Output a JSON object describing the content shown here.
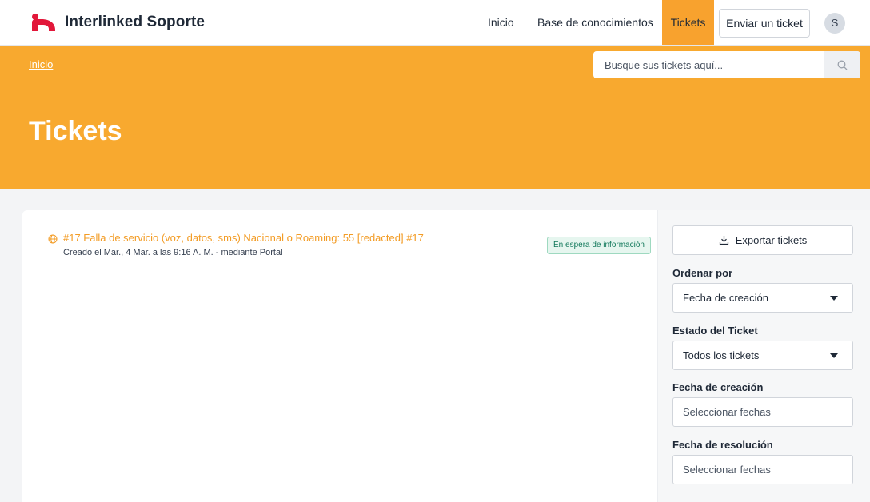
{
  "brand": {
    "name": "Interlinked Soporte",
    "logo_color": "#e2173a"
  },
  "nav": {
    "items": [
      {
        "label": "Inicio"
      },
      {
        "label": "Base de conocimientos"
      },
      {
        "label": "Tickets",
        "active": true
      }
    ],
    "submit_label": "Enviar un ticket",
    "avatar_initial": "S"
  },
  "hero": {
    "breadcrumb": "Inicio",
    "search_placeholder": "Busque sus tickets aquí...",
    "search_icon": "search-icon",
    "title": "Tickets",
    "color": "#f8a92f"
  },
  "tickets": [
    {
      "icon": "globe-icon",
      "title": "#17 Falla de servicio (voz, datos, sms) Nacional o Roaming: 55 [redacted] #17",
      "meta": "Creado el Mar., 4 Mar. a las 9:16 A. M. - mediante Portal",
      "status": "En espera de información",
      "status_color": "#11785a"
    }
  ],
  "sidebar": {
    "export_label": "Exportar tickets",
    "export_icon": "download-icon",
    "sort_label": "Ordenar por",
    "sort_value": "Fecha de creación",
    "status_label": "Estado del Ticket",
    "status_value": "Todos los tickets",
    "created_label": "Fecha de creación",
    "created_placeholder": "Seleccionar fechas",
    "resolved_label": "Fecha de resolución",
    "resolved_placeholder": "Seleccionar fechas"
  },
  "accent": "#f8a22e"
}
